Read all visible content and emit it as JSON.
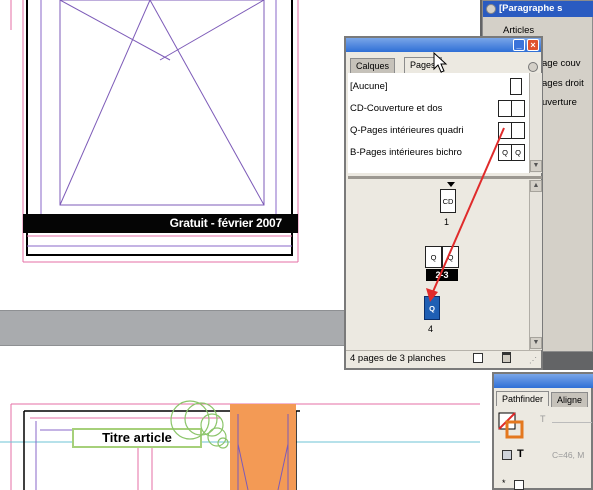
{
  "document": {
    "banner_text": "Gratuit - février 2007",
    "title_article": "Titre article"
  },
  "pages_panel": {
    "tabs": [
      {
        "label": "Calques"
      },
      {
        "label": "Pages"
      }
    ],
    "masters": [
      {
        "label": "[Aucune]"
      },
      {
        "label": "CD-Couverture et dos"
      },
      {
        "label": "Q-Pages intérieures quadri"
      },
      {
        "label": "B-Pages intérieures bichro"
      }
    ],
    "page_thumbs": {
      "cd": "CD",
      "cd_num": "1",
      "q_left": "Q",
      "q_right": "Q",
      "spread_num": "2-3",
      "q_blue": "Q",
      "blue_num": "4",
      "b_left": "Q",
      "b_right": "Q"
    },
    "status": "4 pages de 3 planches"
  },
  "para_panel": {
    "title": "[Paragraphe s",
    "row1": "Articles",
    "row2": "age couv",
    "row3": "ages droit",
    "row4": "uverture"
  },
  "pathfinder_panel": {
    "tabs": [
      {
        "label": "Pathfinder"
      },
      {
        "label": "Aligne"
      }
    ],
    "t_label": "T",
    "color_text": "C=46, M",
    "t_bold": "T"
  },
  "colors": {
    "accent_blue": "#1f5fb4",
    "arrow_red": "#e02b2b",
    "orange": "#f39a55"
  }
}
